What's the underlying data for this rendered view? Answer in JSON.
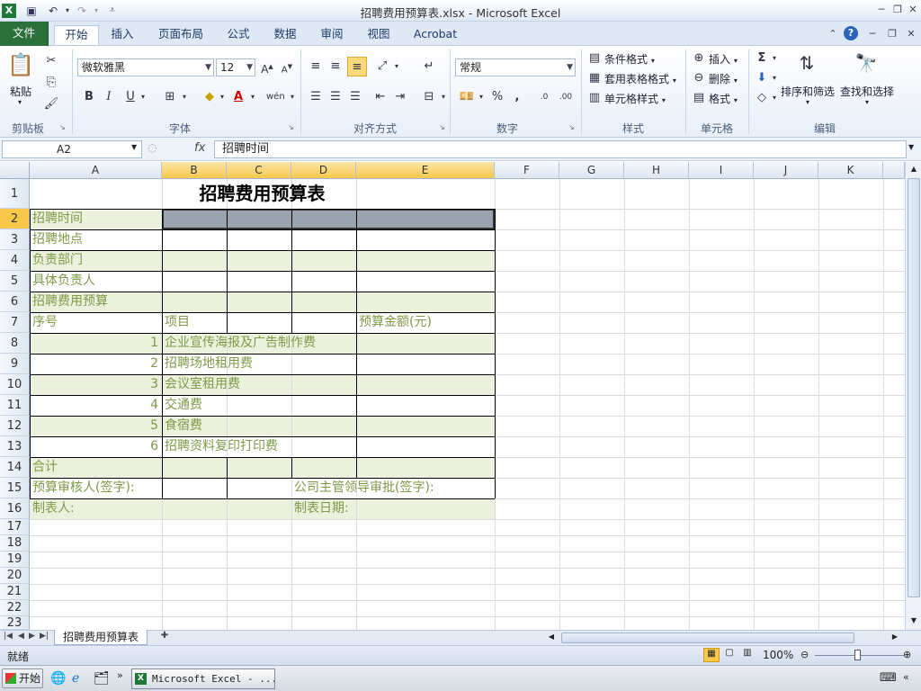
{
  "window": {
    "title": "招聘费用预算表.xlsx  -  Microsoft Excel"
  },
  "ribbon_tabs": [
    "文件",
    "开始",
    "插入",
    "页面布局",
    "公式",
    "数据",
    "审阅",
    "视图",
    "Acrobat"
  ],
  "ribbon": {
    "clipboard": {
      "paste": "粘贴",
      "group": "剪贴板"
    },
    "font": {
      "name": "微软雅黑",
      "size": "12",
      "group": "字体"
    },
    "alignment": {
      "group": "对齐方式"
    },
    "number": {
      "format": "常规",
      "group": "数字"
    },
    "styles": {
      "conditional": "条件格式",
      "table": "套用表格格式",
      "cell_styles": "单元格样式",
      "group": "样式"
    },
    "cells": {
      "insert": "插入",
      "delete": "删除",
      "format": "格式",
      "group": "单元格"
    },
    "editing": {
      "sort": "排序和筛选",
      "find": "查找和选择",
      "group": "编辑"
    }
  },
  "formula_bar": {
    "name_box": "A2",
    "fx": "fx",
    "content": "招聘时间"
  },
  "columns": [
    "A",
    "B",
    "C",
    "D",
    "E",
    "F",
    "G",
    "H",
    "I",
    "J",
    "K"
  ],
  "rows": [
    "1",
    "2",
    "3",
    "4",
    "5",
    "6",
    "7",
    "8",
    "9",
    "10",
    "11",
    "12",
    "13",
    "14",
    "15",
    "16",
    "17",
    "18",
    "19",
    "20",
    "21",
    "22",
    "23"
  ],
  "cells": {
    "title": "招聘费用预算表",
    "r2": "招聘时间",
    "r3": "招聘地点",
    "r4": "负责部门",
    "r5": "具体负责人",
    "r6": "招聘费用预算",
    "r7a": "序号",
    "r7b": "项目",
    "r7e": "预算金额(元)",
    "items": [
      {
        "no": "1",
        "name": "企业宣传海报及广告制作费"
      },
      {
        "no": "2",
        "name": "招聘场地租用费"
      },
      {
        "no": "3",
        "name": "会议室租用费"
      },
      {
        "no": "4",
        "name": "交通费"
      },
      {
        "no": "5",
        "name": "食宿费"
      },
      {
        "no": "6",
        "name": "招聘资料复印打印费"
      }
    ],
    "r14": "合计",
    "r15a": "预算审核人(签字):",
    "r15d": "公司主管领导审批(签字):",
    "r16a": "制表人:",
    "r16d": "制表日期:"
  },
  "sheet_tab": "招聘费用预算表",
  "status": {
    "ready": "就绪",
    "zoom": "100%"
  },
  "taskbar": {
    "start": "开始",
    "app": "Microsoft Excel - ..."
  },
  "colors": {
    "green_text": "#7e9a48",
    "band": "#ebf1dd",
    "sel_header": "#f7c84b",
    "file_tab": "#2b6f3a"
  }
}
